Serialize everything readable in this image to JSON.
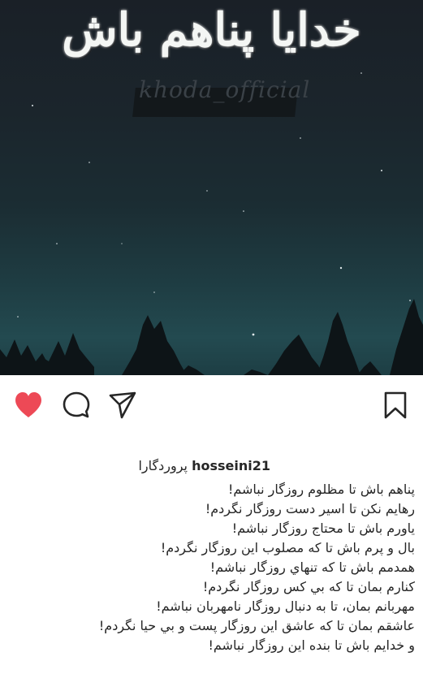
{
  "post": {
    "image": {
      "title_text": "خدایا پناهم باش",
      "watermark_text": "khoda_official",
      "colors": {
        "sky_top": "#1a2027",
        "sky_bottom": "#234a50",
        "trees": "#0d1417"
      }
    },
    "actions": [
      {
        "name": "like",
        "icon": "heart-icon",
        "liked": true,
        "color": "#ed4956"
      },
      {
        "name": "comment",
        "icon": "comment-icon"
      },
      {
        "name": "share",
        "icon": "paper-plane-icon"
      },
      {
        "name": "save",
        "icon": "bookmark-icon"
      }
    ],
    "caption": {
      "username": "hosseini21",
      "title": "پروردگارا",
      "lines": [
        "پناهم باش تا مظلوم روزگار نباشم!",
        "رهایم نکن تا اسیر دست روزگار نگردم!",
        "یاورم باش تا محتاج روزگار نباشم!",
        "بال و پرم باش تا که مصلوب این روزگار نگردم!",
        "همدمم باش تا که تنهاي روزگار نباشم!",
        "کنارم بمان تا که بي کس روزگار نگردم!",
        "مهربانم بمان، تا به دنبال روزگار نامهربان نباشم!",
        "عاشقم بمان تا که عاشق این روزگار پست و بي حيا نگردم!",
        "و خدایم باش تا بنده این روزگار نباشم!"
      ]
    }
  }
}
